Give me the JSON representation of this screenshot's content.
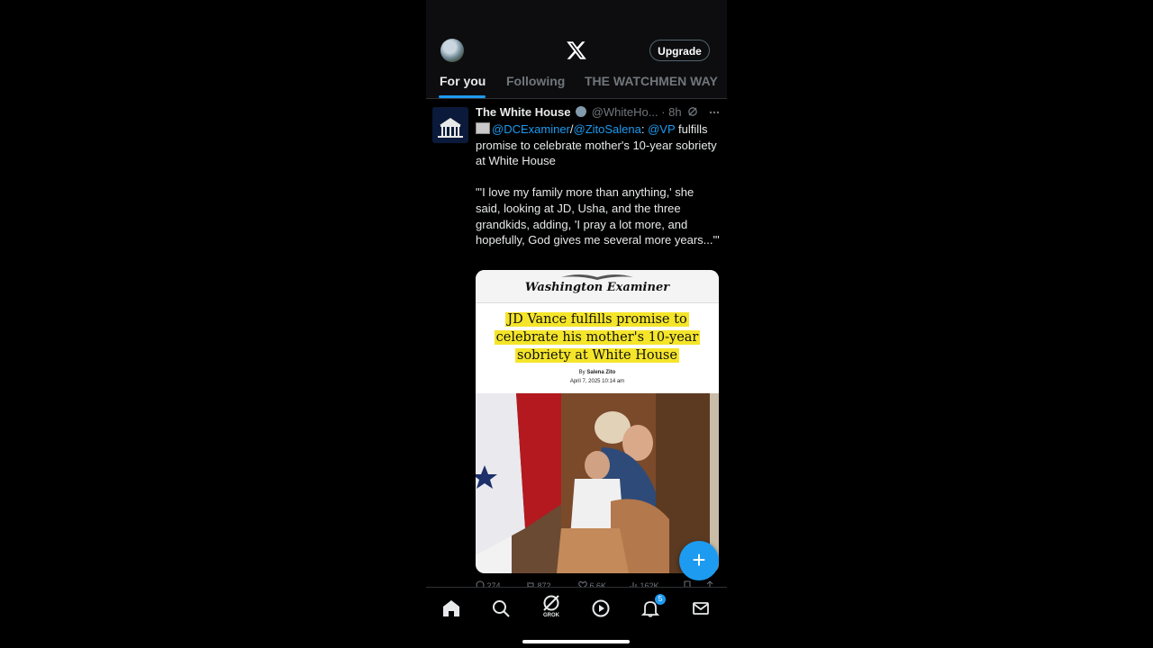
{
  "header": {
    "upgrade_label": "Upgrade"
  },
  "tabs": [
    {
      "label": "For you",
      "active": true
    },
    {
      "label": "Following",
      "active": false
    },
    {
      "label": "THE WATCHMEN WAY",
      "active": false
    }
  ],
  "post": {
    "author_name": "The White House",
    "handle": "@WhiteHo...",
    "time": "· 8h",
    "mention_1": "@DCExaminer",
    "separator_1": "/",
    "mention_2": "@ZitoSalena",
    "separator_2": ": ",
    "mention_3": "@VP",
    "text_1": " fulfills promise to celebrate mother's 10-year sobriety at White House",
    "text_2": "\"'I love my family more than anything,' she said, looking at JD, Usha, and the three grandkids, adding, 'I pray a lot more, and hopefully, God gives me several more years...'\"",
    "card": {
      "masthead": "Washington Examiner",
      "headline_line1": "JD Vance fulfills promise to",
      "headline_line2": "celebrate his mother's 10-year",
      "headline_line3": "sobriety at White House",
      "byline_prefix": "By",
      "author": "Salena Zito",
      "date": "April 7, 2025 10:14 am"
    },
    "stats": {
      "replies": "274",
      "reposts": "872",
      "likes": "6.6K",
      "views": "162K"
    }
  },
  "bottom_nav": {
    "grok_label": "GROK",
    "notification_count": "5"
  },
  "colors": {
    "accent": "#1d9bf0",
    "background": "#000000",
    "highlight": "#f5e52a"
  }
}
